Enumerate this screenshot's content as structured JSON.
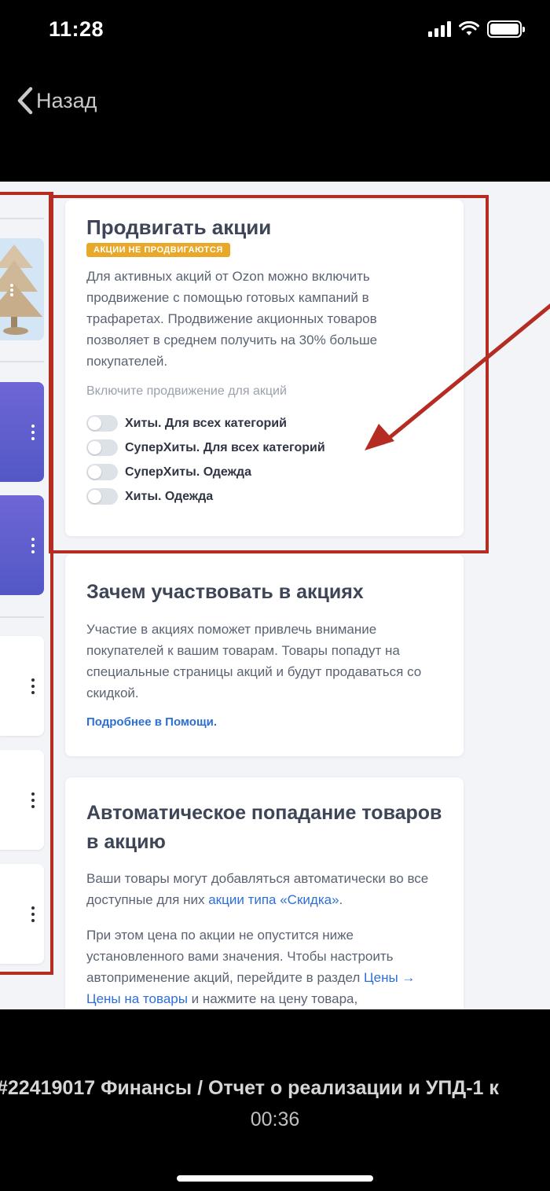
{
  "status_bar": {
    "time": "11:28"
  },
  "nav": {
    "back_label": "Назад"
  },
  "promo_card": {
    "title": "Продвигать акции",
    "badge": "АКЦИИ НЕ ПРОДВИГАЮТСЯ",
    "description": "Для активных акций от Ozon можно включить продвижение с помощью готовых кампаний в трафаретах. Продвижение акционных товаров позволяет в среднем получить на 30% больше покупателей.",
    "toggles_heading": "Включите продвижение для акций",
    "toggles": [
      {
        "label": "Хиты. Для всех категорий"
      },
      {
        "label": "СуперХиты. Для всех категорий"
      },
      {
        "label": "СуперХиты. Одежда"
      },
      {
        "label": "Хиты. Одежда"
      }
    ]
  },
  "why_card": {
    "title": "Зачем участвовать в акциях",
    "description": "Участие в акциях поможет привлечь внимание покупателей к вашим товарам. Товары попадут на специальные страницы акций и будут продаваться со скидкой.",
    "help_link": "Подробнее в Помощи."
  },
  "auto_card": {
    "title": "Автоматическое попадание товаров в акцию",
    "p1_text": "Ваши товары могут добавляться автоматически во все доступные для них ",
    "p1_link": "акции типа «Скидка»",
    "p1_end": ".",
    "p2_text": "При этом цена по акции не опустится ниже установленного вами значения. Чтобы настроить автоприменение акций, перейдите в раздел ",
    "p2_link": "Цены → Цены на товары",
    "p2_end": " и нажмите на цену товара,"
  },
  "video": {
    "title": "#22419017 Финансы / Отчет о реализации и УПД-1 к",
    "time": "00:36"
  },
  "colors": {
    "highlight_box": "#b52d22",
    "badge_bg": "#e8a92a",
    "link": "#2d6fd6",
    "tile_purple": "#5e5ed0"
  }
}
